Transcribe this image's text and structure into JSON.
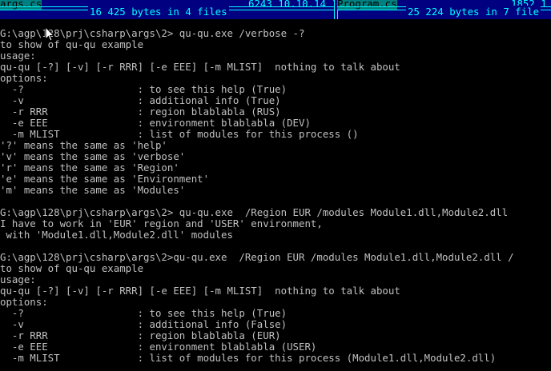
{
  "panels": {
    "left": {
      "filename": "args.cs",
      "file_info": "6243 10.10.14 17:50",
      "summary": "16 425 bytes in 4 files"
    },
    "right": {
      "filename": "Program.cs",
      "file_info": "1852 1",
      "summary": "25 224 bytes in 7 file"
    }
  },
  "console": {
    "lines": [
      "G:\\agp\\128\\prj\\csharp\\args\\2> qu-qu.exe /verbose -?",
      "to show of qu-qu example",
      "usage:",
      "qu-qu [-?] [-v] [-r RRR] [-e EEE] [-m MLIST]  nothing to talk about",
      "options:",
      "  -?                   : to see this help (True)",
      "  -v                   : additional info (True)",
      "  -r RRR               : region blablabla (RUS)",
      "  -e EEE               : environment blablabla (DEV)",
      "  -m MLIST             : list of modules for this process ()",
      "'?' means the same as 'help'",
      "'v' means the same as 'verbose'",
      "'r' means the same as 'Region'",
      "'e' means the same as 'Environment'",
      "'m' means the same as 'Modules'",
      "",
      "G:\\agp\\128\\prj\\csharp\\args\\2> qu-qu.exe  /Region EUR /modules Module1.dll,Module2.dll",
      "I have to work in 'EUR' region and 'USER' environment,",
      " with 'Module1.dll,Module2.dll' modules",
      "",
      "G:\\agp\\128\\prj\\csharp\\args\\2>qu-qu.exe  /Region EUR /modules Module1.dll,Module2.dll /",
      "to show of qu-qu example",
      "usage:",
      "qu-qu [-?] [-v] [-r RRR] [-e EEE] [-m MLIST]  nothing to talk about",
      "options:",
      "  -?                   : to see this help (True)",
      "  -v                   : additional info (False)",
      "  -r RRR               : region blablabla (EUR)",
      "  -e EEE               : environment blablabla (USER)",
      "  -m MLIST             : list of modules for this process (Module1.dll,Module2.dll)"
    ]
  },
  "colors": {
    "background": "#000000",
    "text": "#c0c0c0",
    "panel_bg": "#000080",
    "panel_fg": "#00ffff",
    "panel_selected_bg": "#008080"
  }
}
